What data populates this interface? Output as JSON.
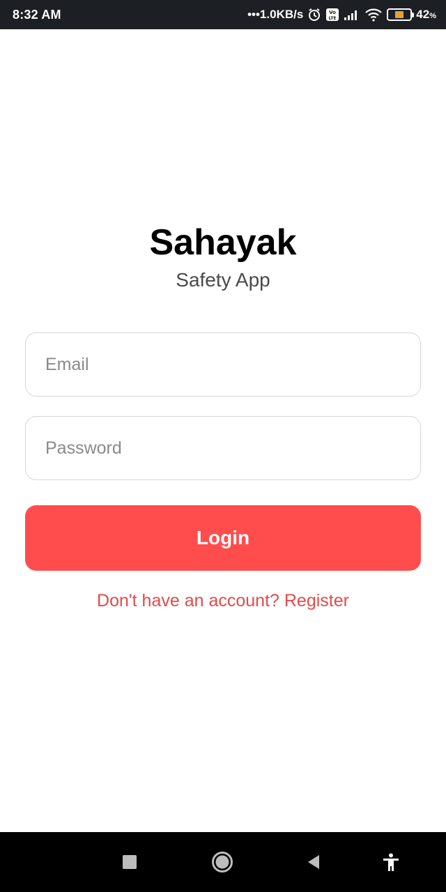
{
  "status_bar": {
    "time": "8:32 AM",
    "network_speed": "•••1.0KB/s",
    "battery_percent": "42",
    "battery_unit": "%",
    "battery_level": 0.42,
    "icons": [
      "alarm-icon",
      "volte-icon",
      "signal-icon",
      "wifi-icon",
      "battery-icon"
    ]
  },
  "app": {
    "title": "Sahayak",
    "subtitle": "Safety App"
  },
  "form": {
    "email_placeholder": "Email",
    "password_placeholder": "Password",
    "login_label": "Login",
    "register_text": "Don't have an account? Register"
  },
  "nav_bar": {
    "icons": [
      "recents-icon",
      "home-icon",
      "back-icon",
      "accessibility-icon"
    ]
  },
  "colors": {
    "accent": "#ff4d4d",
    "link": "#e14b4b",
    "status_bar_bg": "#1c1f23",
    "nav_bar_bg": "#000000"
  }
}
